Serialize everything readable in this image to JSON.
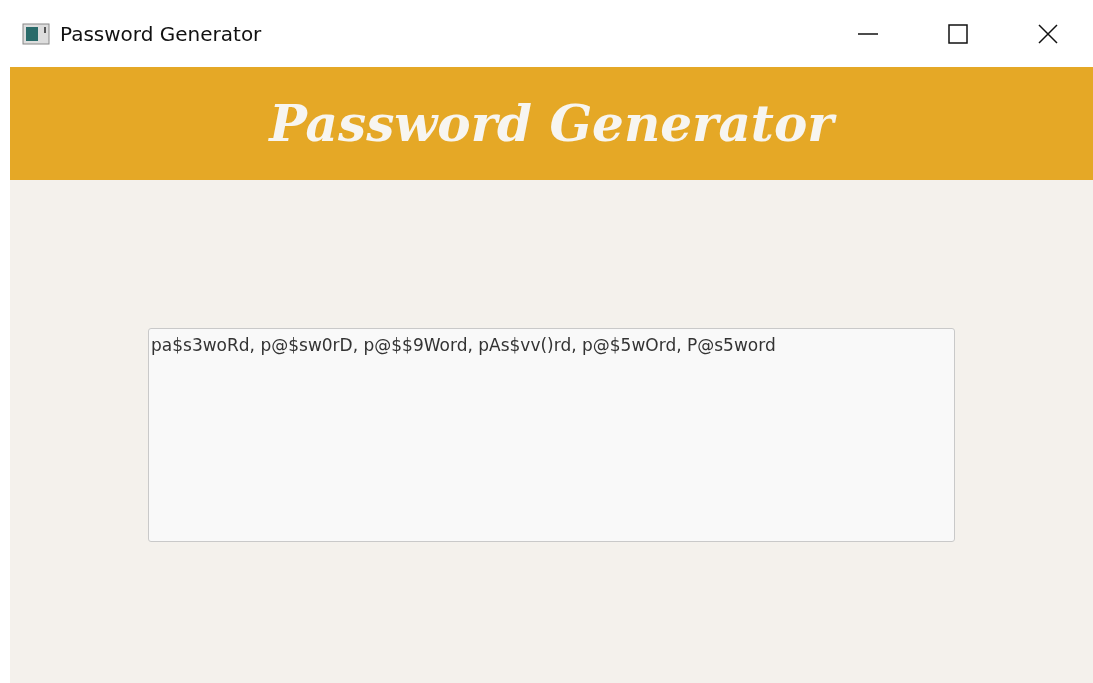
{
  "window": {
    "title": "Password Generator"
  },
  "header": {
    "title": "Password Generator"
  },
  "output": {
    "value": "pa$s3woRd, p@$sw0rD, p@$$9Word, pAs$vv()rd, p@$5wOrd, P@s5word"
  }
}
